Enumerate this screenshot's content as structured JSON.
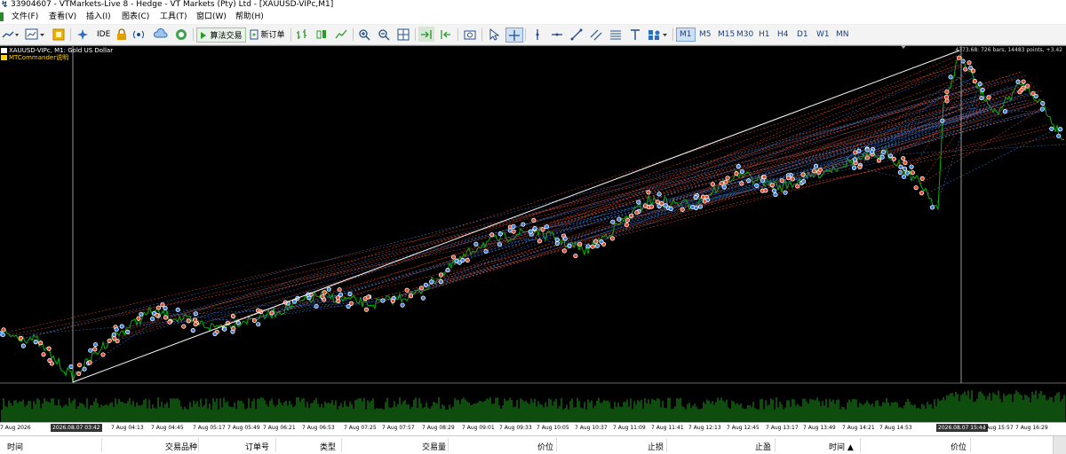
{
  "window": {
    "title": "33904607 - VTMarkets-Live 8 - Hedge - VT Markets (Pty) Ltd - [XAUUSD-VIPc,M1]"
  },
  "menu": [
    "文件(F)",
    "查看(V)",
    "插入(I)",
    "图表(C)",
    "工具(T)",
    "窗口(W)",
    "帮助(H)"
  ],
  "toolbar": {
    "ide_label": "IDE",
    "algo_label": "算法交易",
    "new_order_label": "新订单",
    "timeframes": [
      "M1",
      "M5",
      "M15",
      "M30",
      "H1",
      "H4",
      "D1",
      "W1",
      "MN"
    ],
    "active_timeframe": "M1"
  },
  "chart": {
    "symbol_line": "XAUUSD-VIPc, M1:",
    "symbol_desc": "Gold US Dollar",
    "ea_label": "MTCommander说明",
    "info_box": "4373.68: 726 bars, 14483 points, +3.42",
    "colors": {
      "background": "#000000",
      "price_line": "#00b400",
      "volume": "#1e9a1e",
      "buy_marker": "#3a7bd5",
      "sell_marker": "#e0482a",
      "crosshair": "#bfbfbf",
      "trendline": "#ffffff"
    }
  },
  "time_axis": {
    "labels": [
      "7 Aug 2026",
      "7 Aug 04:13",
      "7 Aug 04:45",
      "7 Aug 05:17",
      "7 Aug 05:49",
      "7 Aug 06:21",
      "7 Aug 06:53",
      "7 Aug 07:25",
      "7 Aug 07:57",
      "7 Aug 08:29",
      "7 Aug 09:01",
      "7 Aug 09:33",
      "7 Aug 10:05",
      "7 Aug 10:37",
      "7 Aug 11:09",
      "7 Aug 11:41",
      "7 Aug 12:13",
      "7 Aug 12:45",
      "7 Aug 13:17",
      "7 Aug 13:49",
      "7 Aug 14:21",
      "7 Aug 14:53",
      "7 Aug 15:57",
      "7 Aug 16:29"
    ],
    "marker_left": "2026.08.07 03:42",
    "marker_right": "2026.08.07 15:48"
  },
  "terminal": {
    "columns": [
      "时间",
      "交易品种",
      "订单号",
      "类型",
      "交易量",
      "价位",
      "止损",
      "止盈",
      "时间 ▲",
      "价位"
    ]
  }
}
